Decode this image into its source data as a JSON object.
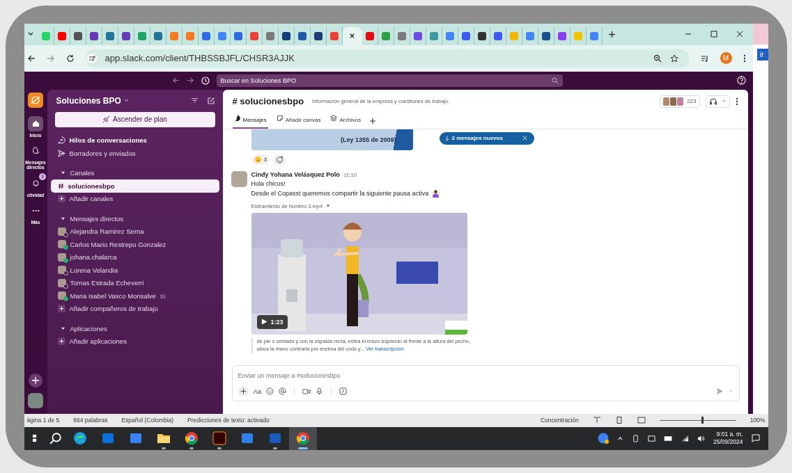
{
  "browser": {
    "tabs": [
      {
        "color": "#25d366",
        "selected": false
      },
      {
        "color": "#ff0000",
        "selected": false
      },
      {
        "color": "#555555",
        "selected": false
      },
      {
        "color": "#673ab7",
        "selected": false
      },
      {
        "color": "#21759b",
        "selected": false
      },
      {
        "color": "#673ab7",
        "selected": false
      },
      {
        "color": "#1fa463",
        "selected": false
      },
      {
        "color": "#21759b",
        "selected": false
      },
      {
        "color": "#f47b20",
        "selected": false
      },
      {
        "color": "#f47b20",
        "selected": false
      },
      {
        "color": "#2d6ae3",
        "selected": false
      },
      {
        "color": "#4285f4",
        "selected": false
      },
      {
        "color": "#2d6ae3",
        "selected": false
      },
      {
        "color": "#ea4335",
        "selected": false
      },
      {
        "color": "#7a7a7a",
        "selected": false
      },
      {
        "color": "#0d3f78",
        "selected": false
      },
      {
        "color": "#1e5aa8",
        "selected": false
      },
      {
        "color": "#1d3d78",
        "selected": false
      },
      {
        "color": "#ea4335",
        "selected": false
      },
      {
        "selected": true
      },
      {
        "color": "#e50914",
        "selected": false
      },
      {
        "color": "#2ea043",
        "selected": false
      },
      {
        "color": "#7a7a7a",
        "selected": false
      },
      {
        "color": "#6a4ce0",
        "selected": false
      },
      {
        "color": "#3b9aa0",
        "selected": false
      },
      {
        "color": "#4285f4",
        "selected": false
      },
      {
        "color": "#3d5af1",
        "selected": false
      },
      {
        "color": "#333333",
        "selected": false
      },
      {
        "color": "#3d5af1",
        "selected": false
      },
      {
        "color": "#f2b705",
        "selected": false
      },
      {
        "color": "#4285f4",
        "selected": false
      },
      {
        "color": "#1d4f8c",
        "selected": false
      },
      {
        "color": "#8b3ff2",
        "selected": false
      },
      {
        "color": "#f2c300",
        "selected": false
      },
      {
        "color": "#4285f4",
        "selected": false
      }
    ],
    "url": "app.slack.com/client/THBSSBJFL/CHSR3AJJK",
    "profile_initial": "M"
  },
  "slack": {
    "search": {
      "placeholder": "Buscar en Soluciones BPO"
    },
    "rail": [
      {
        "label": "Inicio",
        "kind": "home",
        "selected": true
      },
      {
        "label": "Mensajes directos",
        "kind": "dm",
        "selected": false
      },
      {
        "label": "ctividad",
        "kind": "activity",
        "badge": "3",
        "selected": false
      },
      {
        "label": "Más",
        "kind": "more",
        "selected": false
      }
    ],
    "sidebar": {
      "workspace": "Soluciones BPO",
      "upgrade_button": "Ascender de plan",
      "top_items": [
        {
          "label": "Hilos de conversaciones",
          "kind": "threads",
          "bold": true
        },
        {
          "label": "Borradores y enviados",
          "kind": "drafts",
          "bold": false
        }
      ],
      "sections": [
        {
          "title": "Canales",
          "expanded": true,
          "items": [
            {
              "label": "solucionesbpo",
              "kind": "channel",
              "selected": true
            },
            {
              "label": "Añadir canales",
              "kind": "add",
              "selected": false
            }
          ]
        },
        {
          "title": "Mensajes directos",
          "expanded": true,
          "items": [
            {
              "label": "Alejandra Ramirez Serna",
              "kind": "dm",
              "online": false,
              "selected": false
            },
            {
              "label": "Carlos Mario Restrepo Gonzalez",
              "kind": "dm",
              "online": true,
              "selected": false
            },
            {
              "label": "johana.chalarca",
              "kind": "dm",
              "online": true,
              "selected": false
            },
            {
              "label": "Lorena Velandia",
              "kind": "dm",
              "online": false,
              "selected": false
            },
            {
              "label": "Tomas Estrada Echeverri",
              "kind": "dm",
              "online": false,
              "selected": false
            },
            {
              "label": "Maria Isabel Vasco Monsalve",
              "suffix": "tú",
              "kind": "dm",
              "online": true,
              "selected": false
            },
            {
              "label": "Añadir compañeros de trabajo",
              "kind": "add",
              "selected": false
            }
          ]
        },
        {
          "title": "Aplicaciones",
          "expanded": true,
          "items": [
            {
              "label": "Añadir aplicaciones",
              "kind": "add",
              "selected": false
            }
          ]
        }
      ]
    },
    "channel": {
      "name": "# solucionesbpo",
      "description": "Información general de la empresa y cuestiones de trabajo.",
      "member_count": "223",
      "tabs": [
        {
          "label": "Mensajes",
          "kind": "messages",
          "selected": true
        },
        {
          "label": "Añadir canvas",
          "kind": "canvas",
          "selected": false
        },
        {
          "label": "Archivos",
          "kind": "files",
          "selected": false
        }
      ]
    },
    "previous_image_text": "(Ley 1355 de 2009)",
    "reactions": [
      {
        "count": "3"
      }
    ],
    "new_messages_pill": "2 mensajes nuevos",
    "message": {
      "author": "Cindy Yohana Velásquez Polo",
      "time": "11:10",
      "lines": [
        "Hola chicos!",
        "Desde el Copasst queremos compartir la siguiente pausa activa"
      ],
      "attachment": {
        "filename": "Estiramiento de hombro 3.mp4",
        "duration": "1:23",
        "transcript": "de pie o sentado y con la espalda recta, estira el brazo izquierdo al frente a la altura del pecho, ubica la mano contraria por encima del codo y...",
        "transcript_link": "Ver transcripción"
      }
    },
    "composer": {
      "placeholder": "Enviar un mensaje a #solucionesbpo",
      "format_label": "Aa"
    }
  },
  "word": {
    "ribbon_button": "ir",
    "status_left": [
      "ágina 1 de 5",
      "664 palabras",
      "Español (Colombia)",
      "Predicciones de texto: activado"
    ],
    "focus": "Concentración",
    "zoom": {
      "level": 0.55,
      "reading": "100%"
    }
  },
  "taskbar": {
    "apps": [
      {
        "running": false,
        "selected": false
      },
      {
        "running": false,
        "selected": false
      },
      {
        "running": false,
        "selected": false
      },
      {
        "running": true,
        "selected": false
      },
      {
        "running": true,
        "selected": false
      },
      {
        "running": true,
        "selected": false
      },
      {
        "running": false,
        "selected": false
      },
      {
        "running": true,
        "selected": false
      },
      {
        "running": true,
        "selected": true
      }
    ],
    "time": "9:01 a. m.",
    "date": "25/09/2024"
  }
}
